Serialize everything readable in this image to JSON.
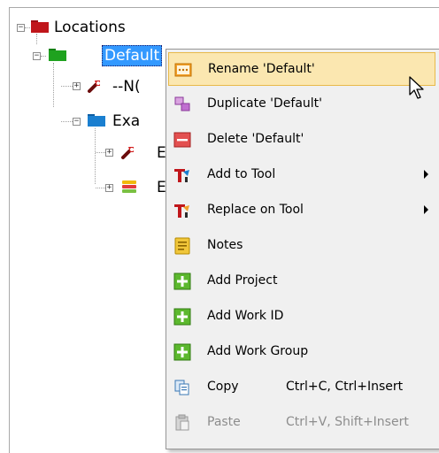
{
  "tree": {
    "root": {
      "label": "Locations",
      "expander": "−",
      "folder_color": "#c0161b"
    },
    "default": {
      "label": "Default",
      "expander": "−",
      "folder_color": "#1fa21f"
    },
    "child1": {
      "label": "--N(",
      "expander": "+"
    },
    "child2": {
      "label": "Exa",
      "expander": "−",
      "folder_color": "#1a7fd0"
    },
    "child3": {
      "label": "E",
      "expander": "+"
    },
    "child4": {
      "label": "E",
      "expander": "+"
    }
  },
  "menu": {
    "items": [
      {
        "label": "Rename 'Default'",
        "icon": "rename-icon",
        "hover": true
      },
      {
        "label": "Duplicate 'Default'",
        "icon": "duplicate-icon"
      },
      {
        "label": "Delete 'Default'",
        "icon": "delete-icon"
      },
      {
        "label": "Add to Tool",
        "icon": "add-to-tool-icon",
        "submenu": true
      },
      {
        "label": "Replace on Tool",
        "icon": "replace-on-tool-icon",
        "submenu": true
      },
      {
        "label": "Notes",
        "icon": "notes-icon"
      },
      {
        "label": "Add Project",
        "icon": "plus-icon"
      },
      {
        "label": "Add Work ID",
        "icon": "plus-icon"
      },
      {
        "label": "Add Work Group",
        "icon": "plus-icon"
      },
      {
        "label": "Copy",
        "shortcut": "Ctrl+C, Ctrl+Insert",
        "icon": "copy-icon"
      },
      {
        "label": "Paste",
        "shortcut": "Ctrl+V, Shift+Insert",
        "icon": "paste-icon",
        "disabled": true
      }
    ]
  },
  "colors": {
    "selection": "#3399ff",
    "menu_hover": "#fbe7b0",
    "menu_bg": "#f0f0f0"
  }
}
